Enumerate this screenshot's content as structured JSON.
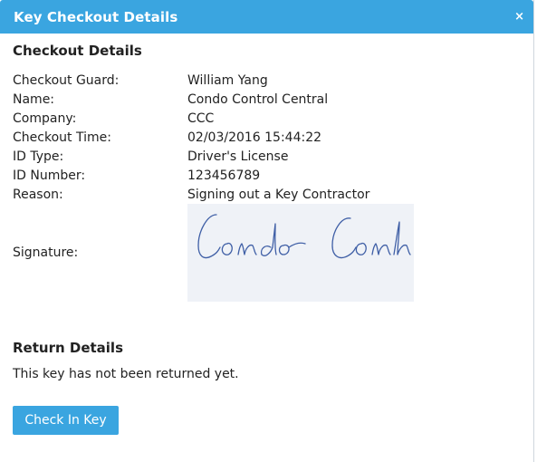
{
  "dialog": {
    "title": "Key Checkout Details",
    "close_glyph": "×"
  },
  "checkout": {
    "heading": "Checkout Details",
    "fields": [
      {
        "label": "Checkout Guard:",
        "value": "William Yang"
      },
      {
        "label": "Name:",
        "value": "Condo Control Central"
      },
      {
        "label": "Company:",
        "value": "CCC"
      },
      {
        "label": "Checkout Time:",
        "value": "02/03/2016 15:44:22"
      },
      {
        "label": "ID Type:",
        "value": "Driver's License"
      },
      {
        "label": "ID Number:",
        "value": "123456789"
      },
      {
        "label": "Reason:",
        "value": "Signing out a Key Contractor"
      }
    ],
    "signature_label": "Signature:",
    "signature_text": "Condo Conh"
  },
  "return": {
    "heading": "Return Details",
    "message": "This key has not been returned yet."
  },
  "actions": {
    "check_in_label": "Check In Key"
  },
  "colors": {
    "accent": "#3aa5e0",
    "signature_bg": "#eff2f7",
    "signature_ink": "#3f5fa6"
  }
}
